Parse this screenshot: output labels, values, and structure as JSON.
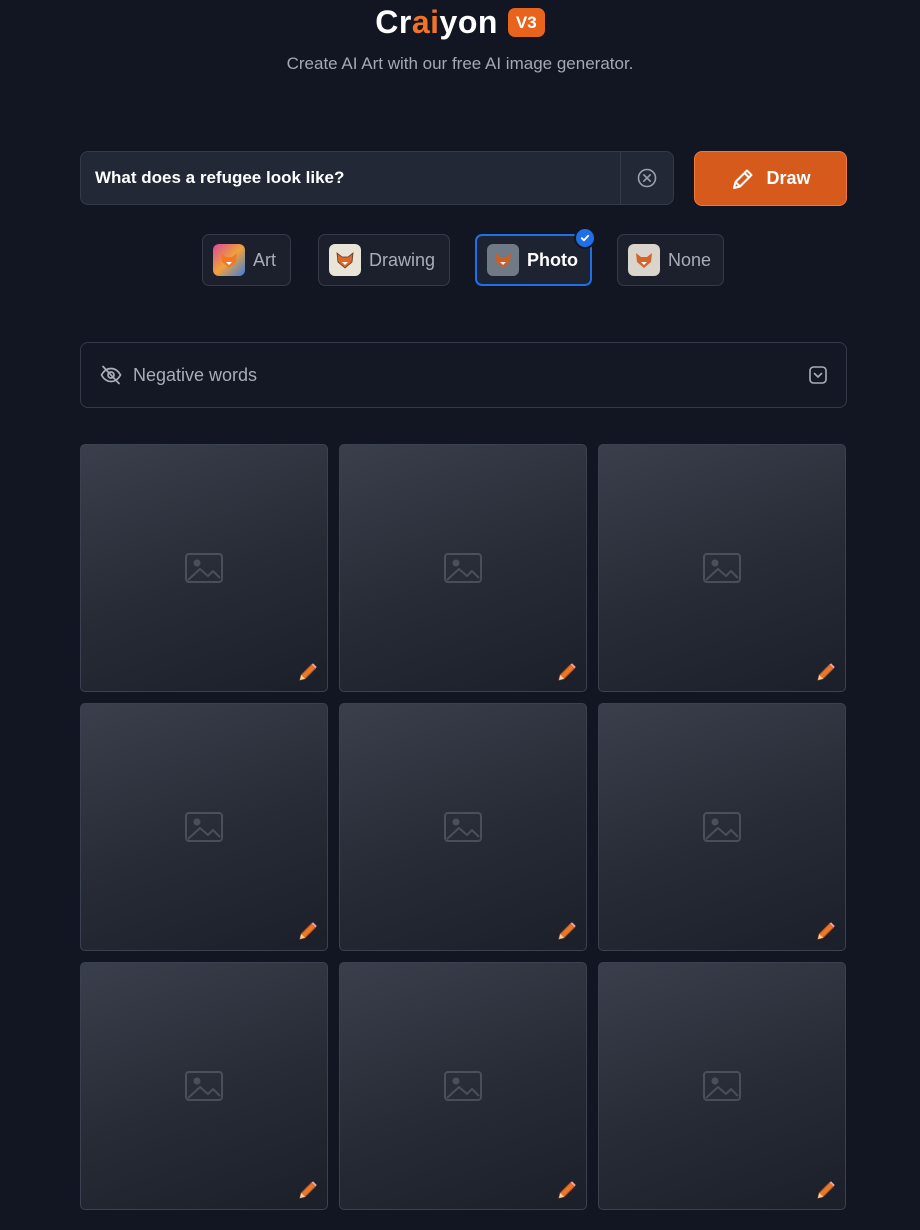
{
  "brand": {
    "name_part1": "Cr",
    "name_part2": "ai",
    "name_part3": "yon",
    "version": "V3",
    "tagline": "Create AI Art with our free AI image generator."
  },
  "prompt": {
    "value": "What does a refugee look like?"
  },
  "draw_button": {
    "label": "Draw"
  },
  "styles": [
    {
      "label": "Art",
      "selected": false
    },
    {
      "label": "Drawing",
      "selected": false
    },
    {
      "label": "Photo",
      "selected": true
    },
    {
      "label": "None",
      "selected": false
    }
  ],
  "negative_words": {
    "label": "Negative words"
  },
  "results": {
    "count": 9
  },
  "colors": {
    "accent": "#d65a1c",
    "selection": "#1f6fe8",
    "background": "#111622"
  }
}
